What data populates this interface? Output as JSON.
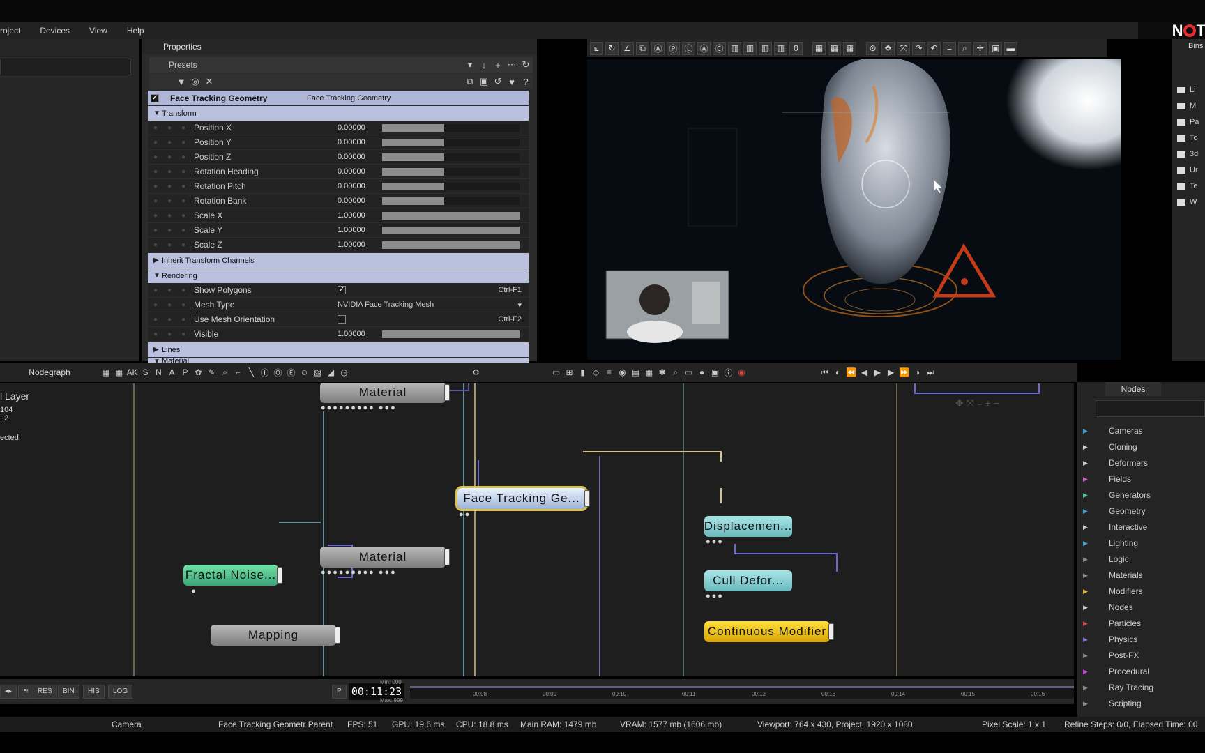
{
  "menu": [
    "roject",
    "Devices",
    "View",
    "Help"
  ],
  "properties": {
    "title": "Properties",
    "presets_label": "Presets",
    "node_name": "Face Tracking Geometry",
    "node_type": "Face Tracking Geometry",
    "sections": {
      "transform": "Transform",
      "inherit": "Inherit Transform Channels",
      "rendering": "Rendering",
      "lines": "Lines",
      "material": "Material"
    },
    "transform_rows": [
      {
        "name": "Position X",
        "value": "0.00000",
        "level": 0.45
      },
      {
        "name": "Position Y",
        "value": "0.00000",
        "level": 0.45
      },
      {
        "name": "Position Z",
        "value": "0.00000",
        "level": 0.45
      },
      {
        "name": "Rotation Heading",
        "value": "0.00000",
        "level": 0.45
      },
      {
        "name": "Rotation Pitch",
        "value": "0.00000",
        "level": 0.45
      },
      {
        "name": "Rotation Bank",
        "value": "0.00000",
        "level": 0.45
      },
      {
        "name": "Scale X",
        "value": "1.00000",
        "level": 1.0
      },
      {
        "name": "Scale Y",
        "value": "1.00000",
        "level": 1.0
      },
      {
        "name": "Scale Z",
        "value": "1.00000",
        "level": 1.0
      }
    ],
    "rendering_rows": {
      "show_polygons": "Show Polygons",
      "show_polygons_shortcut": "Ctrl-F1",
      "mesh_type": "Mesh Type",
      "mesh_type_value": "NVIDIA Face Tracking Mesh",
      "use_mesh_orientation": "Use Mesh Orientation",
      "use_mesh_orientation_shortcut": "Ctrl-F2",
      "visible": "Visible",
      "visible_value": "1.00000",
      "visible_level": 1.0
    }
  },
  "bins": {
    "title": "Bins",
    "items": [
      "Li",
      "M",
      "Pa",
      "To",
      "3d",
      "Ur",
      "Te",
      "W"
    ]
  },
  "nodegraph": {
    "label": "Nodegraph",
    "toolbar_letters": [
      "AK",
      "S",
      "N",
      "A",
      "P"
    ],
    "info_title": "l Layer",
    "info_line1": "104",
    "info_line2": ": 2",
    "info_line3": "ected:",
    "nodes": {
      "material_top": "Material",
      "face_tracking": "Face Tracking Ge...",
      "displacement": "Displacemen...",
      "cull_deformer": "Cull Defor...",
      "material_mid": "Material",
      "fractal_noise": "Fractal Noise...",
      "mapping": "Mapping",
      "continuous_modifier": "Continuous Modifier"
    }
  },
  "nodes_panel": {
    "tab": "Nodes",
    "categories": [
      {
        "name": "Cameras",
        "color": "#4aa3d8"
      },
      {
        "name": "Cloning",
        "color": "#cfcfcf"
      },
      {
        "name": "Deformers",
        "color": "#cfcfcf"
      },
      {
        "name": "Fields",
        "color": "#d05cc8"
      },
      {
        "name": "Generators",
        "color": "#4ac7a6"
      },
      {
        "name": "Geometry",
        "color": "#4aa3d8"
      },
      {
        "name": "Interactive",
        "color": "#cfcfcf"
      },
      {
        "name": "Lighting",
        "color": "#4aa3d8"
      },
      {
        "name": "Logic",
        "color": "#8c8c8c"
      },
      {
        "name": "Materials",
        "color": "#8c8c8c"
      },
      {
        "name": "Modifiers",
        "color": "#e0b732"
      },
      {
        "name": "Nodes",
        "color": "#cfcfcf"
      },
      {
        "name": "Particles",
        "color": "#d84a4a"
      },
      {
        "name": "Physics",
        "color": "#7a7ad8"
      },
      {
        "name": "Post-FX",
        "color": "#8c8c8c"
      },
      {
        "name": "Procedural",
        "color": "#c84ad8"
      },
      {
        "name": "Ray Tracing",
        "color": "#8c8c8c"
      },
      {
        "name": "Scripting",
        "color": "#8c8c8c"
      }
    ]
  },
  "timeline": {
    "buttons": [
      "RES",
      "BIN",
      "HIS",
      "LOG"
    ],
    "play_mode": "P",
    "timecode": "00:11:23",
    "min_label": "Min: 000",
    "max_label": "Max: 999",
    "ticks": [
      "00:08",
      "00:09",
      "00:10",
      "00:11",
      "00:12",
      "00:13",
      "00:14",
      "00:15",
      "00:16"
    ]
  },
  "status": {
    "camera": "Camera",
    "selected": "Face Tracking Geometr Parent",
    "fps": "FPS: 51",
    "gpu": "GPU: 19.6 ms",
    "cpu": "CPU: 18.8 ms",
    "ram": "Main RAM: 1479 mb",
    "vram": "VRAM: 1577 mb (1606 mb)",
    "viewport": "Viewport: 764 x 430, Project: 1920 x 1080",
    "pixel_scale": "Pixel Scale: 1 x 1",
    "refine": "Refine Steps: 0/0, Elapsed Time: 00"
  },
  "logo": "NOTCH"
}
